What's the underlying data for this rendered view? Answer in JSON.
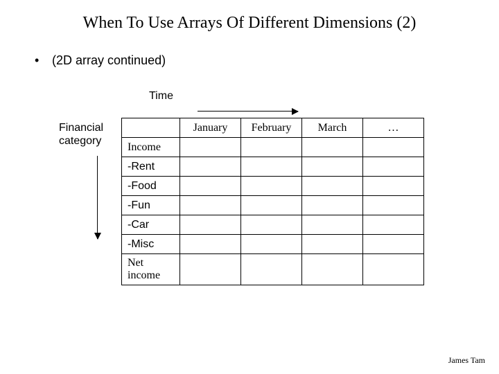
{
  "title": "When To Use Arrays Of Different Dimensions (2)",
  "bullet": "(2D array continued)",
  "labels": {
    "time": "Time",
    "fin_cat": "Financial\ncategory"
  },
  "columns": [
    "January",
    "February",
    "March",
    "…"
  ],
  "rows": [
    "Income",
    "-Rent",
    "-Food",
    "-Fun",
    "-Car",
    "-Misc",
    "Net income"
  ],
  "author": "James Tam"
}
